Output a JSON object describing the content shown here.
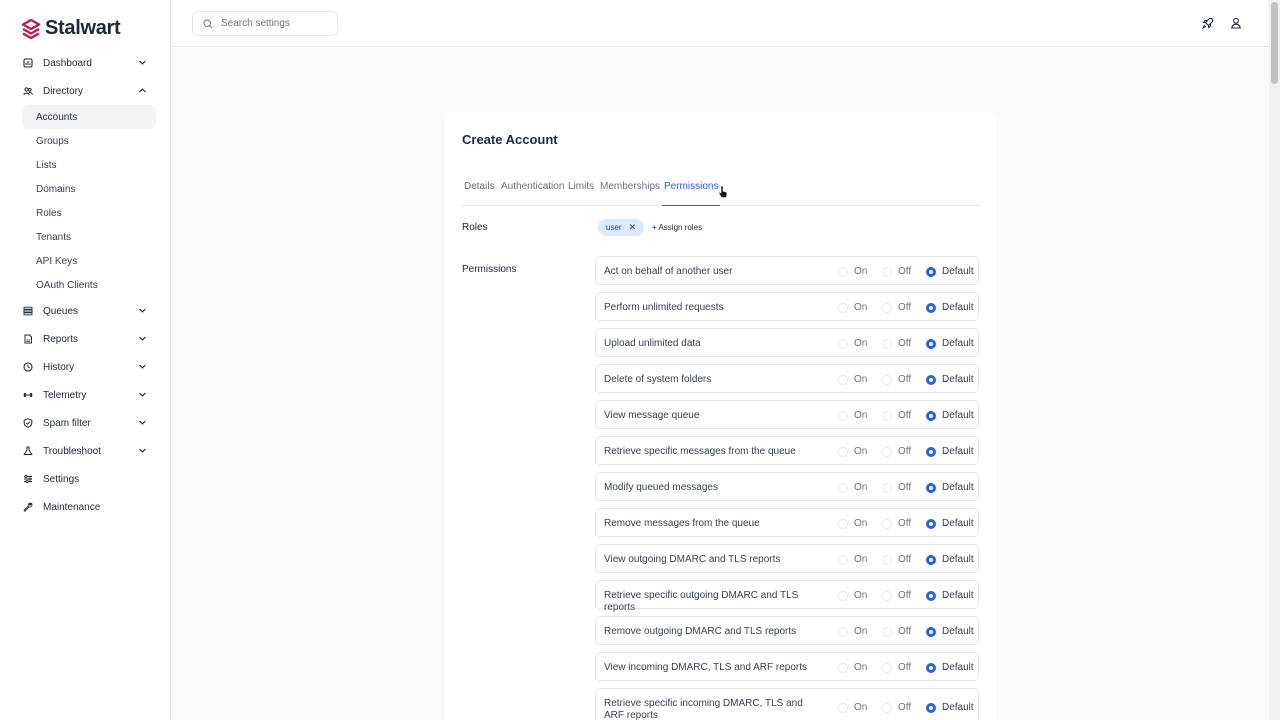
{
  "brand": {
    "name": "Stalwart",
    "color": "#c2185b"
  },
  "search": {
    "placeholder": "Search settings"
  },
  "sidebar": {
    "items": [
      {
        "label": "Dashboard",
        "icon": "dashboard-icon",
        "chevron": "down"
      },
      {
        "label": "Directory",
        "icon": "directory-icon",
        "chevron": "up",
        "children": [
          "Accounts",
          "Groups",
          "Lists",
          "Domains",
          "Roles",
          "Tenants",
          "API Keys",
          "OAuth Clients"
        ],
        "active_child": "Accounts"
      },
      {
        "label": "Queues",
        "icon": "queues-icon",
        "chevron": "down"
      },
      {
        "label": "Reports",
        "icon": "reports-icon",
        "chevron": "down"
      },
      {
        "label": "History",
        "icon": "history-icon",
        "chevron": "down"
      },
      {
        "label": "Telemetry",
        "icon": "telemetry-icon",
        "chevron": "down"
      },
      {
        "label": "Spam filter",
        "icon": "shield-icon",
        "chevron": "down"
      },
      {
        "label": "Troubleshoot",
        "icon": "troubleshoot-icon",
        "chevron": "down"
      },
      {
        "label": "Settings",
        "icon": "settings-icon",
        "chevron": ""
      },
      {
        "label": "Maintenance",
        "icon": "wrench-icon",
        "chevron": ""
      }
    ]
  },
  "card": {
    "title": "Create Account",
    "tabs": [
      "Details",
      "Authentication",
      "Limits",
      "Memberships",
      "Permissions"
    ],
    "active_tab": "Permissions",
    "roles_label": "Roles",
    "role_chip": "user",
    "assign_roles": "+ Assign roles",
    "permissions_label": "Permissions",
    "options": {
      "on": "On",
      "off": "Off",
      "default": "Default"
    },
    "permissions": [
      {
        "name": "Act on behalf of another user",
        "value": "Default"
      },
      {
        "name": "Perform unlimited requests",
        "value": "Default"
      },
      {
        "name": "Upload unlimited data",
        "value": "Default"
      },
      {
        "name": "Delete of system folders",
        "value": "Default"
      },
      {
        "name": "View message queue",
        "value": "Default"
      },
      {
        "name": "Retrieve specific messages from the queue",
        "value": "Default"
      },
      {
        "name": "Modify queued messages",
        "value": "Default"
      },
      {
        "name": "Remove messages from the queue",
        "value": "Default"
      },
      {
        "name": "View outgoing DMARC and TLS reports",
        "value": "Default"
      },
      {
        "name": "Retrieve specific outgoing DMARC and TLS reports",
        "value": "Default"
      },
      {
        "name": "Remove outgoing DMARC and TLS reports",
        "value": "Default"
      },
      {
        "name": "View incoming DMARC, TLS and ARF reports",
        "value": "Default"
      },
      {
        "name": "Retrieve specific incoming DMARC, TLS and ARF reports",
        "value": "Default"
      }
    ]
  },
  "colors": {
    "accent": "#2563eb",
    "chip_bg": "#dbeafe"
  }
}
